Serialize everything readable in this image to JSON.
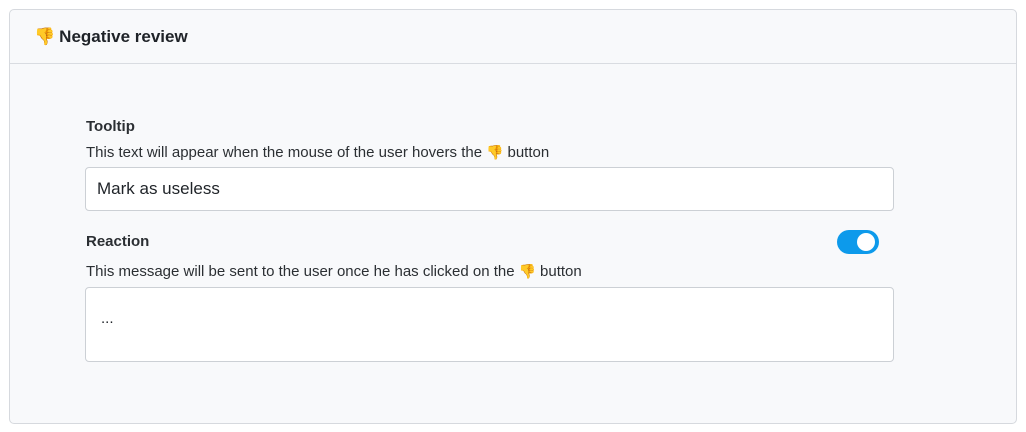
{
  "card": {
    "title_emoji": "👎",
    "title": "Negative review"
  },
  "tooltip": {
    "label": "Tooltip",
    "help_before": "This text will appear when the mouse of the user hovers the",
    "help_emoji": "👎",
    "help_after": "button",
    "value": "Mark as useless"
  },
  "reaction": {
    "label": "Reaction",
    "help_before": "This message will be sent to the user once he has clicked on the",
    "help_emoji": "👎",
    "help_after": "button",
    "value": "...",
    "toggle_on": true
  },
  "colors": {
    "toggle_accent": "#0d9aeb",
    "card_background": "#f8f9fb"
  }
}
